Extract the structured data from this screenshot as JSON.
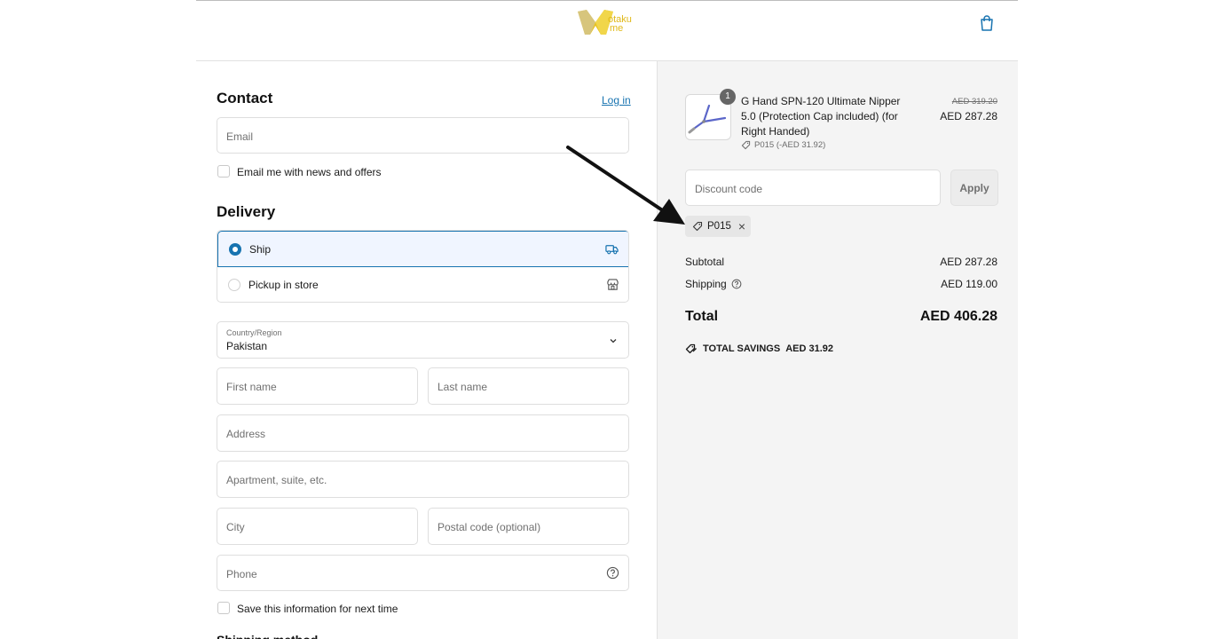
{
  "header": {
    "logo_text_top": "otaku",
    "logo_text_bottom": "me",
    "cart_icon": "shopping-bag-icon",
    "colors": {
      "logo": "#e0b91a",
      "link": "#1773b0"
    }
  },
  "contact": {
    "title": "Contact",
    "login_link": "Log in",
    "email_placeholder": "Email",
    "newsletter_label": "Email me with news and offers"
  },
  "delivery": {
    "title": "Delivery",
    "options": [
      {
        "label": "Ship",
        "selected": true,
        "icon": "truck-icon"
      },
      {
        "label": "Pickup in store",
        "selected": false,
        "icon": "store-icon"
      }
    ],
    "country_label": "Country/Region",
    "country_value": "Pakistan",
    "first_name_placeholder": "First name",
    "last_name_placeholder": "Last name",
    "address_placeholder": "Address",
    "apartment_placeholder": "Apartment, suite, etc.",
    "city_placeholder": "City",
    "postal_placeholder": "Postal code (optional)",
    "phone_placeholder": "Phone",
    "save_info_label": "Save this information for next time"
  },
  "summary": {
    "item": {
      "quantity": "1",
      "name": "G Hand SPN-120 Ultimate Nipper 5.0 (Protection Cap included) (for Right Handed)",
      "discount_line": "P015 (-AED 31.92)",
      "price_old": "AED 319.20",
      "price_new": "AED 287.28"
    },
    "discount_placeholder": "Discount code",
    "apply_label": "Apply",
    "applied_code": "P015",
    "subtotal_label": "Subtotal",
    "subtotal_value": "AED 287.28",
    "shipping_label": "Shipping",
    "shipping_value": "AED 119.00",
    "total_label": "Total",
    "total_value": "AED 406.28",
    "savings_label": "TOTAL SAVINGS",
    "savings_value": "AED 31.92"
  }
}
